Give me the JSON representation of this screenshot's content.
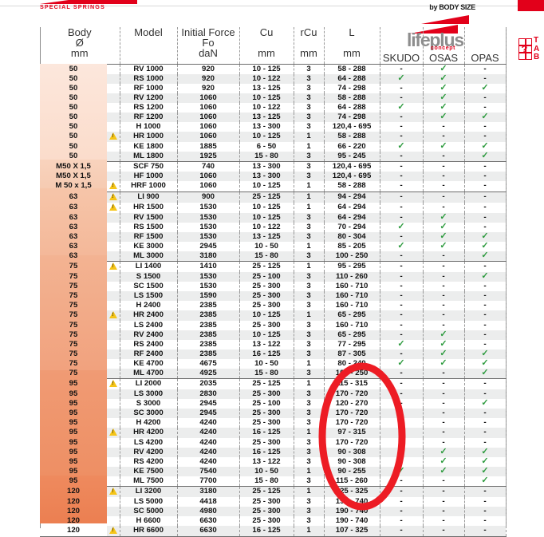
{
  "header": {
    "brand_logo_text": "SPECIAL SPRINGS",
    "by_body_size": "by BODY SIZE",
    "lifeplus_word": "lifeplus",
    "lifeplus_sub": "concept",
    "tab_letters": "TAB",
    "tab_question": "?",
    "accent_red": "#e2001a",
    "check_green": "#2e9b3f"
  },
  "table": {
    "columns": [
      {
        "label": "Body",
        "sub1": "Ø",
        "unit": "mm"
      },
      {
        "label": "Model",
        "sub1": "",
        "unit": ""
      },
      {
        "label": "Initial Force",
        "sub1": "Fo",
        "unit": "daN"
      },
      {
        "label": "Cu",
        "sub1": "",
        "unit": "mm"
      },
      {
        "label": "rCu",
        "sub1": "",
        "unit": "mm"
      },
      {
        "label": "L",
        "sub1": "",
        "unit": "mm"
      },
      {
        "label": "SKUDO",
        "sub1": "",
        "unit": ""
      },
      {
        "label": "OSAS",
        "sub1": "",
        "unit": ""
      },
      {
        "label": "OPAS",
        "sub1": "",
        "unit": ""
      }
    ],
    "check_symbol": "✓",
    "dash_symbol": "-",
    "groups": [
      {
        "id": "50",
        "rows": [
          {
            "body": "50",
            "warn": false,
            "model": "RV 1000",
            "force": "920",
            "cu": "10 - 125",
            "rcu": "3",
            "l": "58 - 288",
            "skudo": "-",
            "osas": "y",
            "opas": "-"
          },
          {
            "body": "50",
            "warn": false,
            "model": "RS 1000",
            "force": "920",
            "cu": "10 - 122",
            "rcu": "3",
            "l": "64 - 288",
            "skudo": "y",
            "osas": "y",
            "opas": "-"
          },
          {
            "body": "50",
            "warn": false,
            "model": "RF 1000",
            "force": "920",
            "cu": "13 - 125",
            "rcu": "3",
            "l": "74 - 298",
            "skudo": "-",
            "osas": "y",
            "opas": "y"
          },
          {
            "body": "50",
            "warn": false,
            "model": "RV 1200",
            "force": "1060",
            "cu": "10 - 125",
            "rcu": "3",
            "l": "58 - 288",
            "skudo": "-",
            "osas": "y",
            "opas": "-"
          },
          {
            "body": "50",
            "warn": false,
            "model": "RS 1200",
            "force": "1060",
            "cu": "10 - 122",
            "rcu": "3",
            "l": "64 - 288",
            "skudo": "y",
            "osas": "y",
            "opas": "-"
          },
          {
            "body": "50",
            "warn": false,
            "model": "RF 1200",
            "force": "1060",
            "cu": "13 - 125",
            "rcu": "3",
            "l": "74 - 298",
            "skudo": "-",
            "osas": "y",
            "opas": "y"
          },
          {
            "body": "50",
            "warn": false,
            "model": "H 1000",
            "force": "1060",
            "cu": "13 - 300",
            "rcu": "3",
            "l": "120,4 - 695",
            "skudo": "-",
            "osas": "-",
            "opas": "-"
          },
          {
            "body": "50",
            "warn": true,
            "model": "HR 1000",
            "force": "1060",
            "cu": "10 - 125",
            "rcu": "1",
            "l": "58 - 288",
            "skudo": "-",
            "osas": "-",
            "opas": "-"
          },
          {
            "body": "50",
            "warn": false,
            "model": "KE 1800",
            "force": "1885",
            "cu": "6 - 50",
            "rcu": "1",
            "l": "66 - 220",
            "skudo": "y",
            "osas": "y",
            "opas": "y"
          },
          {
            "body": "50",
            "warn": false,
            "model": "ML 1800",
            "force": "1925",
            "cu": "15 - 80",
            "rcu": "3",
            "l": "95 - 245",
            "skudo": "-",
            "osas": "-",
            "opas": "y"
          }
        ]
      },
      {
        "id": "m50",
        "rows": [
          {
            "body": "M50 X 1,5",
            "warn": false,
            "model": "SCF 750",
            "force": "740",
            "cu": "13 - 300",
            "rcu": "3",
            "l": "120,4 - 695",
            "skudo": "-",
            "osas": "-",
            "opas": "-"
          },
          {
            "body": "M50 X 1,5",
            "warn": false,
            "model": "HF 1000",
            "force": "1060",
            "cu": "13 - 300",
            "rcu": "3",
            "l": "120,4 - 695",
            "skudo": "-",
            "osas": "-",
            "opas": "-"
          },
          {
            "body": "M 50 x 1,5",
            "warn": true,
            "model": "HRF 1000",
            "force": "1060",
            "cu": "10 - 125",
            "rcu": "1",
            "l": "58 - 288",
            "skudo": "-",
            "osas": "-",
            "opas": "-"
          }
        ]
      },
      {
        "id": "63",
        "rows": [
          {
            "body": "63",
            "warn": true,
            "model": "LI 900",
            "force": "900",
            "cu": "25 - 125",
            "rcu": "1",
            "l": "94 - 294",
            "skudo": "-",
            "osas": "-",
            "opas": "-"
          },
          {
            "body": "63",
            "warn": true,
            "model": "HR 1500",
            "force": "1530",
            "cu": "10 - 125",
            "rcu": "1",
            "l": "64 - 294",
            "skudo": "-",
            "osas": "-",
            "opas": "-"
          },
          {
            "body": "63",
            "warn": false,
            "model": "RV 1500",
            "force": "1530",
            "cu": "10 - 125",
            "rcu": "3",
            "l": "64 - 294",
            "skudo": "-",
            "osas": "y",
            "opas": "-"
          },
          {
            "body": "63",
            "warn": false,
            "model": "RS 1500",
            "force": "1530",
            "cu": "10 - 122",
            "rcu": "3",
            "l": "70 - 294",
            "skudo": "y",
            "osas": "y",
            "opas": "-"
          },
          {
            "body": "63",
            "warn": false,
            "model": "RF 1500",
            "force": "1530",
            "cu": "13 - 125",
            "rcu": "3",
            "l": "80 - 304",
            "skudo": "-",
            "osas": "y",
            "opas": "y"
          },
          {
            "body": "63",
            "warn": false,
            "model": "KE 3000",
            "force": "2945",
            "cu": "10 - 50",
            "rcu": "1",
            "l": "85 - 205",
            "skudo": "y",
            "osas": "y",
            "opas": "y"
          },
          {
            "body": "63",
            "warn": false,
            "model": "ML 3000",
            "force": "3180",
            "cu": "15 - 80",
            "rcu": "3",
            "l": "100 - 250",
            "skudo": "-",
            "osas": "-",
            "opas": "y"
          }
        ]
      },
      {
        "id": "75",
        "rows": [
          {
            "body": "75",
            "warn": true,
            "model": "LI 1400",
            "force": "1410",
            "cu": "25 - 125",
            "rcu": "1",
            "l": "95 - 295",
            "skudo": "-",
            "osas": "-",
            "opas": "-"
          },
          {
            "body": "75",
            "warn": false,
            "model": "S 1500",
            "force": "1530",
            "cu": "25 - 100",
            "rcu": "3",
            "l": "110 - 260",
            "skudo": "-",
            "osas": "-",
            "opas": "y"
          },
          {
            "body": "75",
            "warn": false,
            "model": "SC 1500",
            "force": "1530",
            "cu": "25 - 300",
            "rcu": "3",
            "l": "160 - 710",
            "skudo": "-",
            "osas": "-",
            "opas": "-"
          },
          {
            "body": "75",
            "warn": false,
            "model": "LS 1500",
            "force": "1590",
            "cu": "25 - 300",
            "rcu": "3",
            "l": "160 - 710",
            "skudo": "-",
            "osas": "-",
            "opas": "-"
          },
          {
            "body": "75",
            "warn": false,
            "model": "H 2400",
            "force": "2385",
            "cu": "25 - 300",
            "rcu": "3",
            "l": "160 - 710",
            "skudo": "-",
            "osas": "-",
            "opas": "-"
          },
          {
            "body": "75",
            "warn": true,
            "model": "HR 2400",
            "force": "2385",
            "cu": "10 - 125",
            "rcu": "1",
            "l": "65 - 295",
            "skudo": "-",
            "osas": "-",
            "opas": "-"
          },
          {
            "body": "75",
            "warn": false,
            "model": "LS 2400",
            "force": "2385",
            "cu": "25 - 300",
            "rcu": "3",
            "l": "160 - 710",
            "skudo": "-",
            "osas": "-",
            "opas": "-"
          },
          {
            "body": "75",
            "warn": false,
            "model": "RV 2400",
            "force": "2385",
            "cu": "10 - 125",
            "rcu": "3",
            "l": "65 - 295",
            "skudo": "-",
            "osas": "y",
            "opas": "-"
          },
          {
            "body": "75",
            "warn": false,
            "model": "RS 2400",
            "force": "2385",
            "cu": "13 - 122",
            "rcu": "3",
            "l": "77 - 295",
            "skudo": "y",
            "osas": "y",
            "opas": "-"
          },
          {
            "body": "75",
            "warn": false,
            "model": "RF 2400",
            "force": "2385",
            "cu": "16 - 125",
            "rcu": "3",
            "l": "87 - 305",
            "skudo": "-",
            "osas": "y",
            "opas": "y"
          },
          {
            "body": "75",
            "warn": false,
            "model": "KE 4700",
            "force": "4675",
            "cu": "10 - 50",
            "rcu": "1",
            "l": "80 - 240",
            "skudo": "y",
            "osas": "y",
            "opas": "y"
          },
          {
            "body": "75",
            "warn": false,
            "model": "ML 4700",
            "force": "4925",
            "cu": "15 - 80",
            "rcu": "3",
            "l": "100 - 250",
            "skudo": "-",
            "osas": "-",
            "opas": "y"
          }
        ]
      },
      {
        "id": "95",
        "rows": [
          {
            "body": "95",
            "warn": true,
            "model": "LI 2000",
            "force": "2035",
            "cu": "25 - 125",
            "rcu": "1",
            "l": "115 - 315",
            "skudo": "-",
            "osas": "-",
            "opas": "-"
          },
          {
            "body": "95",
            "warn": false,
            "model": "LS 3000",
            "force": "2830",
            "cu": "25 - 300",
            "rcu": "3",
            "l": "170 - 720",
            "skudo": "-",
            "osas": "-",
            "opas": "-"
          },
          {
            "body": "95",
            "warn": false,
            "model": "S 3000",
            "force": "2945",
            "cu": "25 - 100",
            "rcu": "3",
            "l": "120 - 270",
            "skudo": "-",
            "osas": "-",
            "opas": "y"
          },
          {
            "body": "95",
            "warn": false,
            "model": "SC 3000",
            "force": "2945",
            "cu": "25 - 300",
            "rcu": "3",
            "l": "170 - 720",
            "skudo": "-",
            "osas": "-",
            "opas": "-"
          },
          {
            "body": "95",
            "warn": false,
            "model": "H 4200",
            "force": "4240",
            "cu": "25 - 300",
            "rcu": "3",
            "l": "170 - 720",
            "skudo": "-",
            "osas": "-",
            "opas": "-"
          },
          {
            "body": "95",
            "warn": true,
            "model": "HR 4200",
            "force": "4240",
            "cu": "16 - 125",
            "rcu": "1",
            "l": "97 - 315",
            "skudo": "-",
            "osas": "-",
            "opas": "-"
          },
          {
            "body": "95",
            "warn": false,
            "model": "LS 4200",
            "force": "4240",
            "cu": "25 - 300",
            "rcu": "3",
            "l": "170 - 720",
            "skudo": "-",
            "osas": "-",
            "opas": "-"
          },
          {
            "body": "95",
            "warn": false,
            "model": "RV 4200",
            "force": "4240",
            "cu": "16 - 125",
            "rcu": "3",
            "l": "90 - 308",
            "skudo": "-",
            "osas": "y",
            "opas": "y"
          },
          {
            "body": "95",
            "warn": false,
            "model": "RS 4200",
            "force": "4240",
            "cu": "13 - 122",
            "rcu": "3",
            "l": "90 - 308",
            "skudo": "y",
            "osas": "y",
            "opas": "y"
          },
          {
            "body": "95",
            "warn": false,
            "model": "KE 7500",
            "force": "7540",
            "cu": "10 - 50",
            "rcu": "1",
            "l": "90 - 255",
            "skudo": "y",
            "osas": "y",
            "opas": "y"
          },
          {
            "body": "95",
            "warn": false,
            "model": "ML 7500",
            "force": "7700",
            "cu": "15 - 80",
            "rcu": "3",
            "l": "115 - 260",
            "skudo": "-",
            "osas": "-",
            "opas": "y"
          }
        ]
      },
      {
        "id": "120",
        "rows": [
          {
            "body": "120",
            "warn": true,
            "model": "LI 3200",
            "force": "3180",
            "cu": "25 - 125",
            "rcu": "1",
            "l": "125 - 325",
            "skudo": "-",
            "osas": "-",
            "opas": "-"
          },
          {
            "body": "120",
            "warn": false,
            "model": "LS 5000",
            "force": "4418",
            "cu": "25 - 300",
            "rcu": "3",
            "l": "190 - 740",
            "skudo": "-",
            "osas": "-",
            "opas": "-"
          },
          {
            "body": "120",
            "warn": false,
            "model": "SC 5000",
            "force": "4980",
            "cu": "25 - 300",
            "rcu": "3",
            "l": "190 - 740",
            "skudo": "-",
            "osas": "-",
            "opas": "-"
          },
          {
            "body": "120",
            "warn": false,
            "model": "H 6600",
            "force": "6630",
            "cu": "25 - 300",
            "rcu": "3",
            "l": "190 - 740",
            "skudo": "-",
            "osas": "-",
            "opas": "-"
          },
          {
            "body": "120",
            "warn": true,
            "model": "HR 6600",
            "force": "6630",
            "cu": "16 - 125",
            "rcu": "1",
            "l": "107 - 325",
            "skudo": "-",
            "osas": "-",
            "opas": "-"
          }
        ]
      }
    ]
  },
  "annotation": {
    "type": "ellipse",
    "color": "#ed1c24",
    "target_column": "L"
  }
}
